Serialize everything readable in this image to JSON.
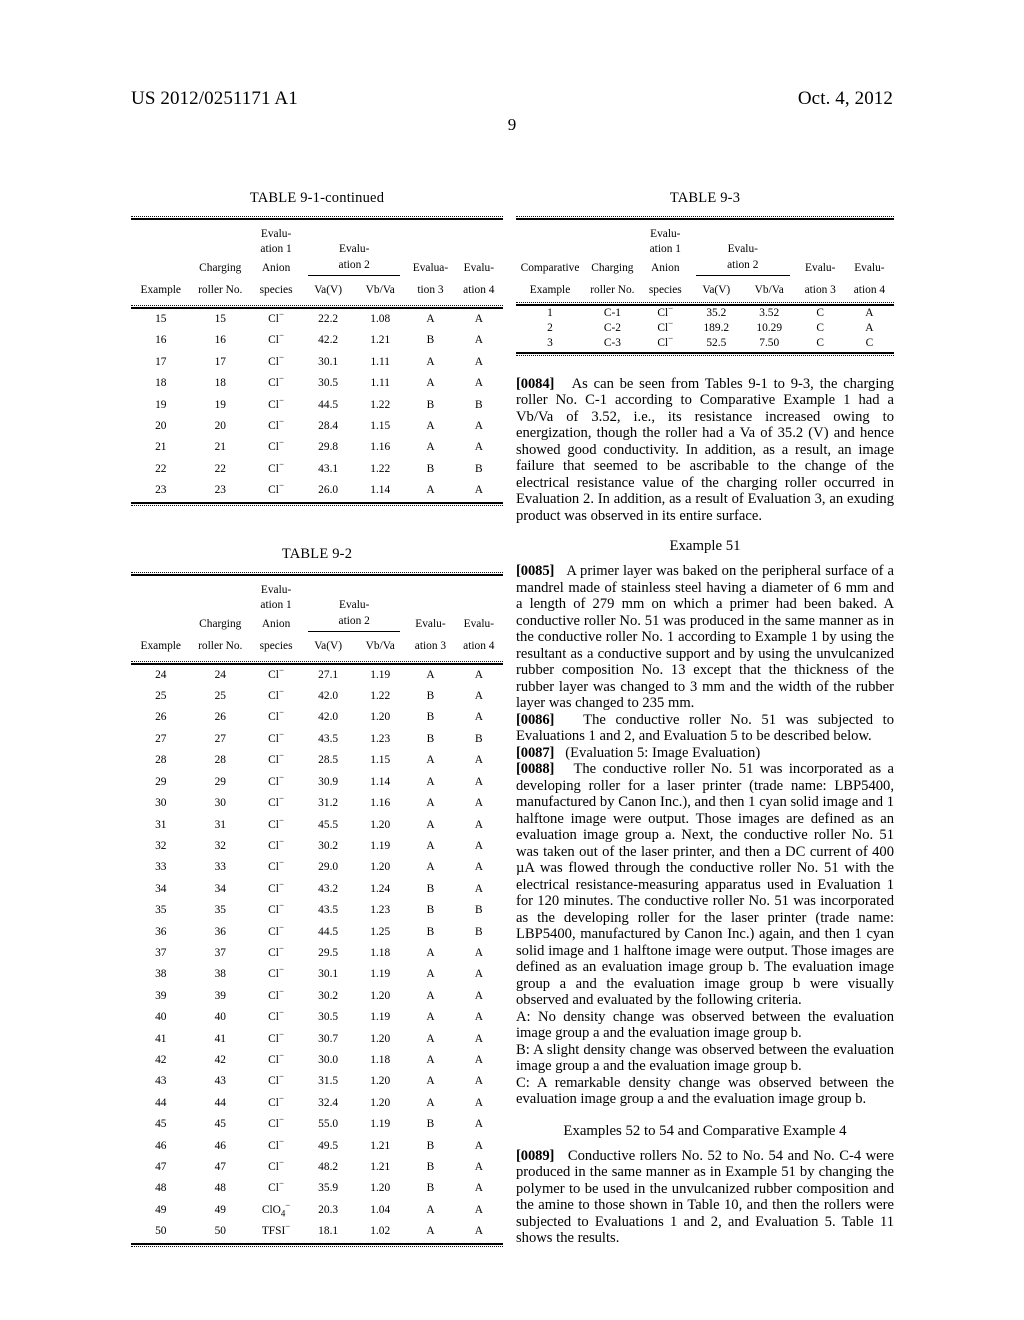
{
  "header": {
    "publication_number": "US 2012/0251171 A1",
    "publication_date": "Oct. 4, 2012",
    "page_number": "9"
  },
  "tables": {
    "t91cont": {
      "caption": "TABLE 9-1-continued",
      "header": {
        "r1": [
          "",
          "",
          "Evalu-",
          "",
          "",
          "",
          ""
        ],
        "r2": [
          "",
          "",
          "ation 1",
          "Evalu-",
          "",
          "",
          ""
        ],
        "r3": [
          "",
          "Charging",
          "Anion",
          "ation 2",
          "Evalua-",
          "Evalu-"
        ],
        "r4": [
          "Example",
          "roller No.",
          "species",
          "Va(V)",
          "Vb/Va",
          "tion 3",
          "ation 4"
        ]
      },
      "rows": [
        [
          "15",
          "15",
          "Cl",
          "22.2",
          "1.08",
          "A",
          "A"
        ],
        [
          "16",
          "16",
          "Cl",
          "42.2",
          "1.21",
          "B",
          "A"
        ],
        [
          "17",
          "17",
          "Cl",
          "30.1",
          "1.11",
          "A",
          "A"
        ],
        [
          "18",
          "18",
          "Cl",
          "30.5",
          "1.11",
          "A",
          "A"
        ],
        [
          "19",
          "19",
          "Cl",
          "44.5",
          "1.22",
          "B",
          "B"
        ],
        [
          "20",
          "20",
          "Cl",
          "28.4",
          "1.15",
          "A",
          "A"
        ],
        [
          "21",
          "21",
          "Cl",
          "29.8",
          "1.16",
          "A",
          "A"
        ],
        [
          "22",
          "22",
          "Cl",
          "43.1",
          "1.22",
          "B",
          "B"
        ],
        [
          "23",
          "23",
          "Cl",
          "26.0",
          "1.14",
          "A",
          "A"
        ]
      ]
    },
    "t92": {
      "caption": "TABLE 9-2",
      "header": {
        "r1": [
          "",
          "",
          "Evalu-",
          "",
          "",
          "",
          ""
        ],
        "r2": [
          "",
          "",
          "ation 1",
          "Evalu-",
          "",
          "",
          ""
        ],
        "r3": [
          "",
          "Charging",
          "Anion",
          "ation 2",
          "Evalu-",
          "Evalu-"
        ],
        "r4": [
          "Example",
          "roller No.",
          "species",
          "Va(V)",
          "Vb/Va",
          "ation 3",
          "ation 4"
        ]
      },
      "rows": [
        [
          "24",
          "24",
          "Cl",
          "27.1",
          "1.19",
          "A",
          "A"
        ],
        [
          "25",
          "25",
          "Cl",
          "42.0",
          "1.22",
          "B",
          "A"
        ],
        [
          "26",
          "26",
          "Cl",
          "42.0",
          "1.20",
          "B",
          "A"
        ],
        [
          "27",
          "27",
          "Cl",
          "43.5",
          "1.23",
          "B",
          "B"
        ],
        [
          "28",
          "28",
          "Cl",
          "28.5",
          "1.15",
          "A",
          "A"
        ],
        [
          "29",
          "29",
          "Cl",
          "30.9",
          "1.14",
          "A",
          "A"
        ],
        [
          "30",
          "30",
          "Cl",
          "31.2",
          "1.16",
          "A",
          "A"
        ],
        [
          "31",
          "31",
          "Cl",
          "45.5",
          "1.20",
          "A",
          "A"
        ],
        [
          "32",
          "32",
          "Cl",
          "30.2",
          "1.19",
          "A",
          "A"
        ],
        [
          "33",
          "33",
          "Cl",
          "29.0",
          "1.20",
          "A",
          "A"
        ],
        [
          "34",
          "34",
          "Cl",
          "43.2",
          "1.24",
          "B",
          "A"
        ],
        [
          "35",
          "35",
          "Cl",
          "43.5",
          "1.23",
          "B",
          "B"
        ],
        [
          "36",
          "36",
          "Cl",
          "44.5",
          "1.25",
          "B",
          "B"
        ],
        [
          "37",
          "37",
          "Cl",
          "29.5",
          "1.18",
          "A",
          "A"
        ],
        [
          "38",
          "38",
          "Cl",
          "30.1",
          "1.19",
          "A",
          "A"
        ],
        [
          "39",
          "39",
          "Cl",
          "30.2",
          "1.20",
          "A",
          "A"
        ],
        [
          "40",
          "40",
          "Cl",
          "30.5",
          "1.19",
          "A",
          "A"
        ],
        [
          "41",
          "41",
          "Cl",
          "30.7",
          "1.20",
          "A",
          "A"
        ],
        [
          "42",
          "42",
          "Cl",
          "30.0",
          "1.18",
          "A",
          "A"
        ],
        [
          "43",
          "43",
          "Cl",
          "31.5",
          "1.20",
          "A",
          "A"
        ],
        [
          "44",
          "44",
          "Cl",
          "32.4",
          "1.20",
          "A",
          "A"
        ],
        [
          "45",
          "45",
          "Cl",
          "55.0",
          "1.19",
          "B",
          "A"
        ],
        [
          "46",
          "46",
          "Cl",
          "49.5",
          "1.21",
          "B",
          "A"
        ],
        [
          "47",
          "47",
          "Cl",
          "48.2",
          "1.21",
          "B",
          "A"
        ],
        [
          "48",
          "48",
          "Cl",
          "35.9",
          "1.20",
          "B",
          "A"
        ],
        [
          "49",
          "49",
          "ClO4",
          "20.3",
          "1.04",
          "A",
          "A"
        ],
        [
          "50",
          "50",
          "TFSI",
          "18.1",
          "1.02",
          "A",
          "A"
        ]
      ]
    },
    "t93": {
      "caption": "TABLE 9-3",
      "header": {
        "r1": [
          "",
          "",
          "Evalu-",
          "",
          "",
          "",
          ""
        ],
        "r2": [
          "",
          "",
          "ation 1",
          "Evalu-",
          "",
          "",
          ""
        ],
        "r3": [
          "Comparative",
          "Charging",
          "Anion",
          "ation 2",
          "Evalu-",
          "Evalu-"
        ],
        "r4": [
          "Example",
          "roller No.",
          "species",
          "Va(V)",
          "Vb/Va",
          "ation 3",
          "ation 4"
        ]
      },
      "rows": [
        [
          "1",
          "C-1",
          "Cl",
          "35.2",
          "3.52",
          "C",
          "A"
        ],
        [
          "2",
          "C-2",
          "Cl",
          "189.2",
          "10.29",
          "C",
          "A"
        ],
        [
          "3",
          "C-3",
          "Cl",
          "52.5",
          "7.50",
          "C",
          "C"
        ]
      ]
    }
  },
  "body": {
    "p0084": {
      "tag": "[0084]",
      "text": "As can be seen from Tables 9-1 to 9-3, the charging roller No. C-1 according to Comparative Example 1 had a Vb/Va of 3.52, i.e., its resistance increased owing to energization, though the roller had a Va of 35.2 (V) and hence showed good conductivity. In addition, as a result, an image failure that seemed to be ascribable to the change of the electrical resistance value of the charging roller occurred in Evaluation 2. In addition, as a result of Evaluation 3, an exuding product was observed in its entire surface."
    },
    "heading_example51": "Example 51",
    "p0085": {
      "tag": "[0085]",
      "text": "A primer layer was baked on the peripheral surface of a mandrel made of stainless steel having a diameter of 6 mm and a length of 279 mm on which a primer had been baked. A conductive roller No. 51 was produced in the same manner as in the conductive roller No. 1 according to Example 1 by using the resultant as a conductive support and by using the unvulcanized rubber composition No. 13 except that the thickness of the rubber layer was changed to 3 mm and the width of the rubber layer was changed to 235 mm."
    },
    "p0086": {
      "tag": "[0086]",
      "text": "The conductive roller No. 51 was subjected to Evaluations 1 and 2, and Evaluation 5 to be described below."
    },
    "p0087": {
      "tag": "[0087]",
      "text": "(Evaluation 5: Image Evaluation)"
    },
    "p0088": {
      "tag": "[0088]",
      "text": "The conductive roller No. 51 was incorporated as a developing roller for a laser printer (trade name: LBP5400, manufactured by Canon Inc.), and then 1 cyan solid image and 1 halftone image were output. Those images are defined as an evaluation image group a. Next, the conductive roller No. 51 was taken out of the laser printer, and then a DC current of 400 µA was flowed through the conductive roller No. 51 with the electrical resistance-measuring apparatus used in Evaluation 1 for 120 minutes. The conductive roller No. 51 was incorporated as the developing roller for the laser printer (trade name: LBP5400, manufactured by Canon Inc.) again, and then 1 cyan solid image and 1 halftone image were output. Those images are defined as an evaluation image group b. The evaluation image group a and the evaluation image group b were visually observed and evaluated by the following criteria."
    },
    "criterion_a": "A: No density change was observed between the evaluation image group a and the evaluation image group b.",
    "criterion_b": "B: A slight density change was observed between the evaluation image group a and the evaluation image group b.",
    "criterion_c": "C: A remarkable density change was observed between the evaluation image group a and the evaluation image group b.",
    "heading_examples52to54": "Examples 52 to 54 and Comparative Example 4",
    "p0089": {
      "tag": "[0089]",
      "text": "Conductive rollers No. 52 to No. 54 and No. C-4 were produced in the same manner as in Example 51 by changing the polymer to be used in the unvulcanized rubber composition and the amine to those shown in Table 10, and then the rollers were subjected to Evaluations 1 and 2, and Evaluation 5. Table 11 shows the results."
    }
  }
}
